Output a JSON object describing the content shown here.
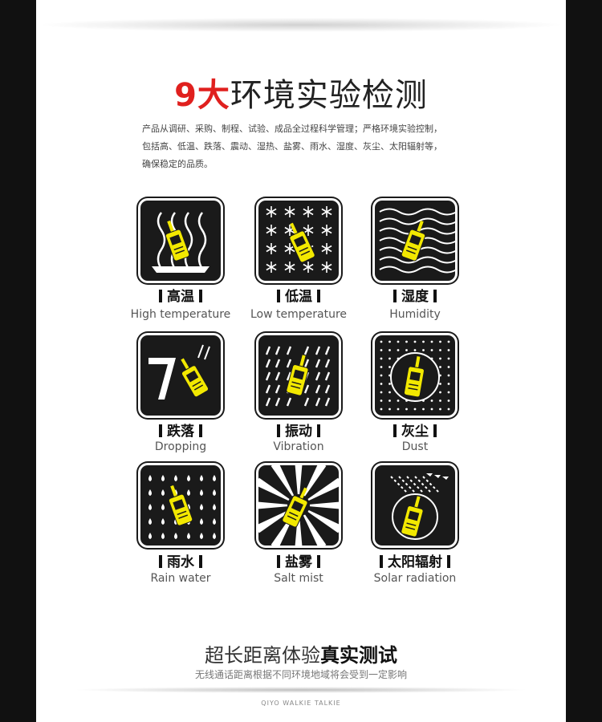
{
  "header": {
    "title_number": "9大",
    "title_rest": "环境实验检测"
  },
  "intro": {
    "line1": "产品从调研、采购、制程、试验、成品全过程科学管理；严格环境实验控制，",
    "line2": "包括高、低温、跌落、震动、湿热、盐雾、雨水、湿度、灰尘、太阳辐射等，",
    "line3": "确保稳定的品质。"
  },
  "tests": [
    {
      "cn": "高温",
      "en": "High temperature",
      "icon": "high-temperature-icon"
    },
    {
      "cn": "低温",
      "en": "Low temperature",
      "icon": "low-temperature-icon"
    },
    {
      "cn": "湿度",
      "en": "Humidity",
      "icon": "humidity-icon"
    },
    {
      "cn": "跌落",
      "en": "Dropping",
      "icon": "dropping-icon"
    },
    {
      "cn": "振动",
      "en": "Vibration",
      "icon": "vibration-icon"
    },
    {
      "cn": "灰尘",
      "en": "Dust",
      "icon": "dust-icon"
    },
    {
      "cn": "雨水",
      "en": "Rain water",
      "icon": "rain-water-icon"
    },
    {
      "cn": "盐雾",
      "en": "Salt mist",
      "icon": "salt-mist-icon"
    },
    {
      "cn": "太阳辐射",
      "en": "Solar radiation",
      "icon": "solar-radiation-icon"
    }
  ],
  "footer": {
    "title_normal": "超长距离体验",
    "title_bold": "真实测试",
    "subtitle": "无线通话距离根据不同环境地域将会受到一定影响",
    "brand": "QIYO WALKIE TALKIE"
  },
  "colors": {
    "accent_red": "#e0201e",
    "icon_yellow": "#f2e800",
    "icon_bg": "#1a1a1a"
  }
}
